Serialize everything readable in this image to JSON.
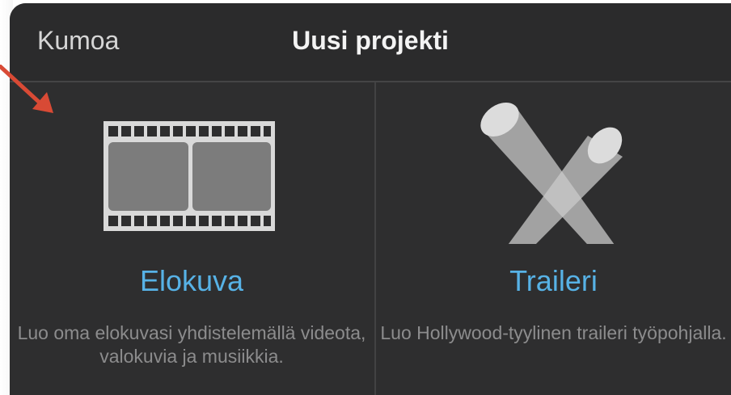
{
  "header": {
    "cancel_label": "Kumoa",
    "title": "Uusi projekti"
  },
  "options": [
    {
      "title": "Elokuva",
      "description": "Luo oma elokuvasi yhdistelemällä videota, valokuvia ja musiikkia.",
      "icon": "film-strip-icon"
    },
    {
      "title": "Traileri",
      "description": "Luo Hollywood-tyylinen traileri työpohjalla.",
      "icon": "spotlights-icon"
    }
  ],
  "colors": {
    "panel_bg": "#2e2e2f",
    "accent": "#57b2e6",
    "annotation_arrow": "#d84a35"
  }
}
